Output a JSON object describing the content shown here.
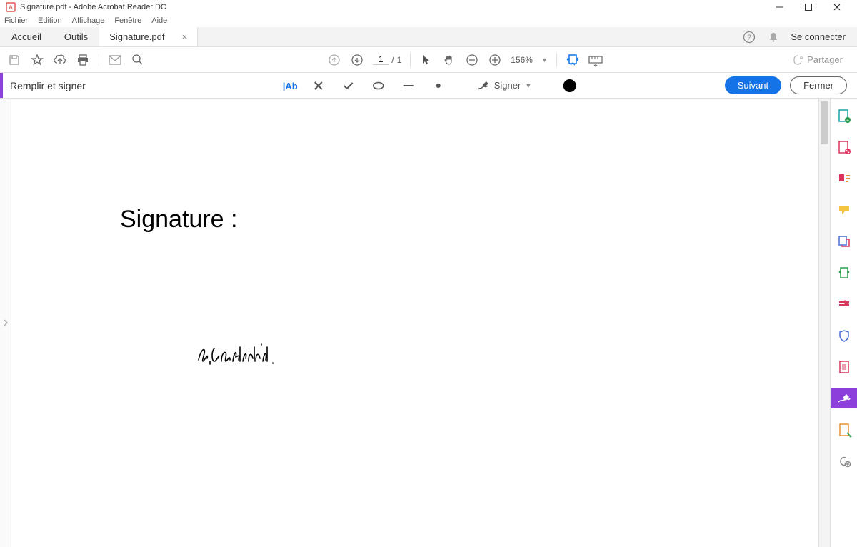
{
  "window": {
    "title": "Signature.pdf - Adobe Acrobat Reader DC"
  },
  "menu": {
    "items": [
      "Fichier",
      "Edition",
      "Affichage",
      "Fenêtre",
      "Aide"
    ]
  },
  "tabs": {
    "home": "Accueil",
    "tools": "Outils",
    "doc": "Signature.pdf",
    "signin": "Se connecter"
  },
  "toolbar": {
    "page_current": "1",
    "page_sep": "/",
    "page_total": "1",
    "zoom": "156%",
    "share": "Partager"
  },
  "fillsign": {
    "label": "Remplir et signer",
    "signer": "Signer",
    "next": "Suivant",
    "close": "Fermer"
  },
  "document": {
    "title": "Signature :",
    "signature_name": "Fr.Andraud."
  },
  "icons": {
    "save": "save-icon",
    "star": "star-icon",
    "cloud": "cloud-upload-icon",
    "print": "print-icon",
    "mail": "mail-icon",
    "search": "search-icon",
    "up": "page-up-icon",
    "down": "page-down-icon",
    "pointer": "pointer-icon",
    "hand": "hand-icon",
    "zoomout": "zoom-out-icon",
    "zoomin": "zoom-in-icon",
    "fitwidth": "fit-width-icon",
    "ruler": "ruler-icon",
    "text": "text-tool-icon",
    "x": "x-tool-icon",
    "check": "check-tool-icon",
    "circle": "circle-tool-icon",
    "line": "line-tool-icon",
    "dot": "dot-tool-icon",
    "signpen": "sign-pen-icon",
    "help": "help-icon",
    "bell": "bell-icon"
  }
}
